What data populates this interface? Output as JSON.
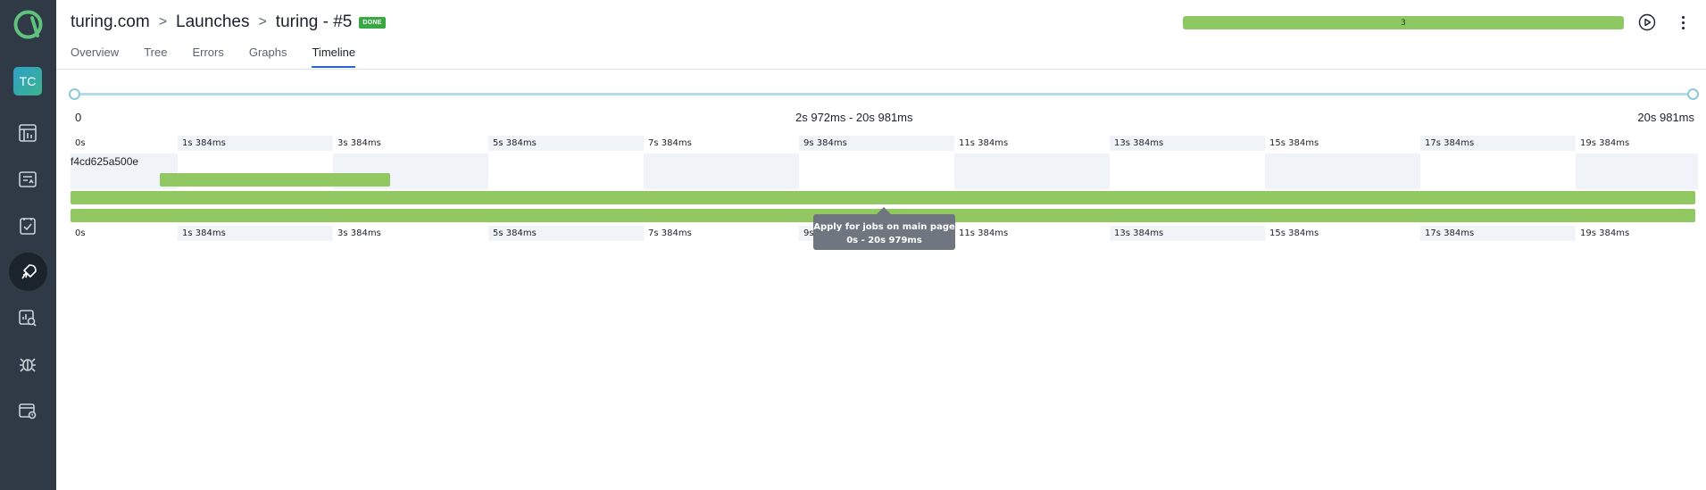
{
  "sidebar": {
    "avatar_initials": "TC",
    "items": [
      {
        "icon": "dashboard-icon"
      },
      {
        "icon": "test-cases-icon"
      },
      {
        "icon": "test-plans-icon"
      },
      {
        "icon": "launches-icon",
        "active": true
      },
      {
        "icon": "analytics-icon"
      },
      {
        "icon": "defects-icon"
      },
      {
        "icon": "jobs-icon"
      }
    ]
  },
  "header": {
    "breadcrumb": {
      "project": "turing.com",
      "section": "Launches",
      "launch": "turing - #5"
    },
    "status_badge": "DONE",
    "status_count": "3",
    "status_color": "#8dc862"
  },
  "tabs": [
    {
      "label": "Overview"
    },
    {
      "label": "Tree"
    },
    {
      "label": "Errors"
    },
    {
      "label": "Graphs"
    },
    {
      "label": "Timeline",
      "active": true
    }
  ],
  "timeline": {
    "range_start": "0",
    "range_selection": "2s 972ms - 20s 981ms",
    "range_end": "20s 981ms",
    "ticks": [
      "0s",
      "1s 384ms",
      "3s 384ms",
      "5s 384ms",
      "7s 384ms",
      "9s 384ms",
      "11s 384ms",
      "13s 384ms",
      "15s 384ms",
      "17s 384ms",
      "19s 384ms"
    ],
    "lane_label": "f4cd625a500e",
    "bar_color": "#92c862",
    "tooltip": {
      "title": "Apply for jobs on main page",
      "time": "0s - 20s 979ms"
    }
  }
}
